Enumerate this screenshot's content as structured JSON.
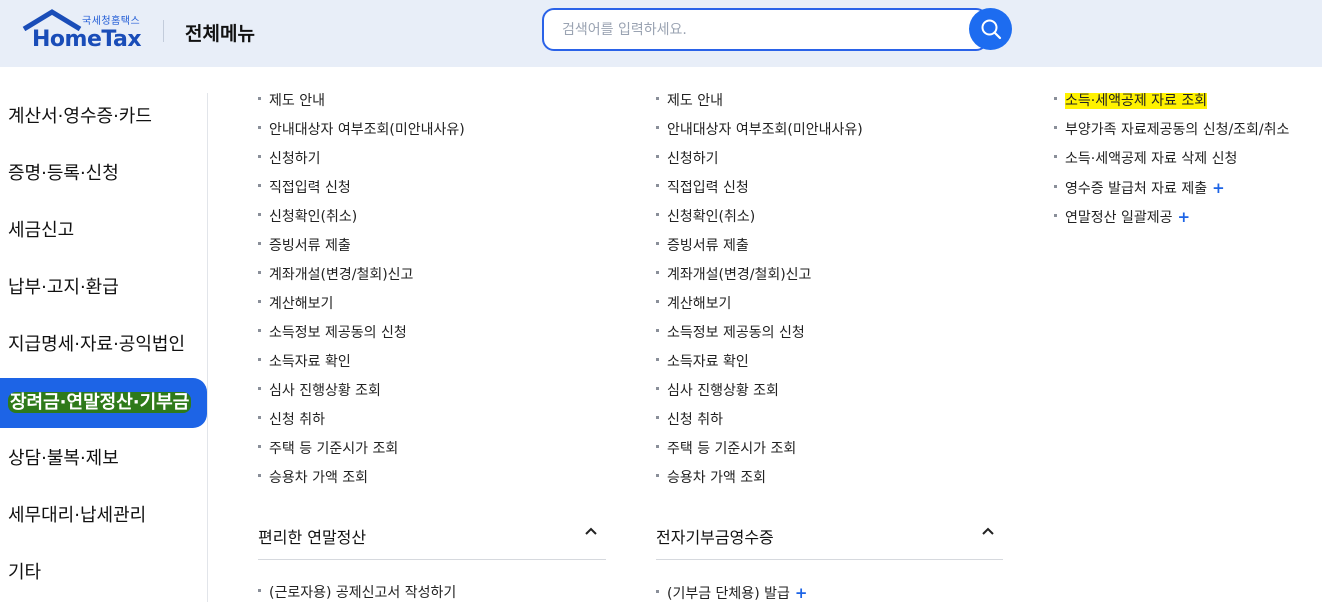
{
  "header": {
    "logo_sub": "국세청홈택스",
    "logo_main": "HomeTax",
    "title": "전체메뉴",
    "search_placeholder": "검색어를 입력하세요."
  },
  "left_nav": [
    {
      "label": "계산서·영수증·카드",
      "active": false
    },
    {
      "label": "증명·등록·신청",
      "active": false
    },
    {
      "label": "세금신고",
      "active": false
    },
    {
      "label": "납부·고지·환급",
      "active": false
    },
    {
      "label": "지급명세·자료·공익법인",
      "active": false
    },
    {
      "label": "장려금·연말정산·기부금",
      "active": true
    },
    {
      "label": "상담·불복·제보",
      "active": false
    },
    {
      "label": "세무대리·납세관리",
      "active": false
    },
    {
      "label": "기타",
      "active": false
    }
  ],
  "col1": {
    "items": [
      "제도 안내",
      "안내대상자 여부조회(미안내사유)",
      "신청하기",
      "직접입력 신청",
      "신청확인(취소)",
      "증빙서류 제출",
      "계좌개설(변경/철회)신고",
      "계산해보기",
      "소득정보 제공동의 신청",
      "소득자료 확인",
      "심사 진행상황 조회",
      "신청 취하",
      "주택 등 기준시가 조회",
      "승용차 가액 조회"
    ],
    "section_title": "편리한 연말정산",
    "section_items": [
      "(근로자용) 공제신고서 작성하기"
    ]
  },
  "col2": {
    "items": [
      "제도 안내",
      "안내대상자 여부조회(미안내사유)",
      "신청하기",
      "직접입력 신청",
      "신청확인(취소)",
      "증빙서류 제출",
      "계좌개설(변경/철회)신고",
      "계산해보기",
      "소득정보 제공동의 신청",
      "소득자료 확인",
      "심사 진행상황 조회",
      "신청 취하",
      "주택 등 기준시가 조회",
      "승용차 가액 조회"
    ],
    "section_title": "전자기부금영수증",
    "section_items": [
      "(기부금 단체용) 발급"
    ]
  },
  "col3": {
    "items": [
      {
        "label": "소득·세액공제 자료 조회",
        "highlight": true,
        "plus": false
      },
      {
        "label": "부양가족 자료제공동의 신청/조회/취소",
        "highlight": false,
        "plus": false
      },
      {
        "label": "소득·세액공제 자료 삭제 신청",
        "highlight": false,
        "plus": false
      },
      {
        "label": "영수증 발급처 자료 제출",
        "highlight": false,
        "plus": true
      },
      {
        "label": "연말정산 일괄제공",
        "highlight": false,
        "plus": true
      }
    ]
  },
  "colors": {
    "accent": "#1d64e6",
    "highlight": "#fff200",
    "header_bg": "#e8eef8"
  },
  "icons": {
    "search": "search-icon",
    "collapse": "chevron-up-icon",
    "expand_more": "plus-icon"
  }
}
